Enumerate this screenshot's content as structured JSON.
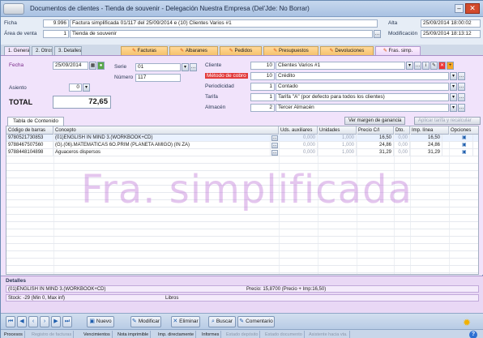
{
  "window": {
    "title": "Documentos de clientes - Tienda de souvenir - Delegación Nuestra Empresa (Del'Jde: No Borrar)"
  },
  "header": {
    "ficha_label": "Ficha",
    "ficha_id": "9.996",
    "ficha_desc": "Factura simplificada 01/117 del 25/09/2014 e (10) Clientes Varios #1",
    "area_label": "Área de venta",
    "area_code": "1",
    "area_name": "Tienda de souvenir",
    "alta_label": "Alta",
    "alta_value": "25/09/2014 18:00:02",
    "mod_label": "Modificación",
    "mod_value": "25/09/2014 18:13:12"
  },
  "tabs": [
    {
      "label": "1. General"
    },
    {
      "label": "2. Otros"
    },
    {
      "label": "3. Detalles"
    },
    {
      "label": "Facturas"
    },
    {
      "label": "Albaranes"
    },
    {
      "label": "Pedidos"
    },
    {
      "label": "Presupuestos"
    },
    {
      "label": "Devoluciones"
    },
    {
      "label": "Fras. simp."
    }
  ],
  "general": {
    "fecha_label": "Fecha",
    "fecha_value": "25/09/2014",
    "asiento_label": "Asiento",
    "asiento_value": "0",
    "total_label": "TOTAL",
    "total_value": "72,65",
    "serie_label": "Serie",
    "serie_value": "01",
    "numero_label": "Número",
    "numero_value": "117",
    "cliente_label": "Cliente",
    "cliente_code": "10",
    "cliente_name": "Clientes Varios #1",
    "metodo_label": "Método de cobro",
    "metodo_code": "10",
    "metodo_name": "Crédito",
    "period_label": "Periodicidad",
    "period_code": "1",
    "period_name": "Contado",
    "tarifa_label": "Tarifa",
    "tarifa_code": "1",
    "tarifa_name": "Tarifa \"A\" (por defecto para todos los clientes)",
    "almacen_label": "Almacén",
    "almacen_code": "2",
    "almacen_name": "Tercer Almacén"
  },
  "contents": {
    "tab_label": "Tabla de Contenido",
    "margin_button": "Ver margen de ganancia",
    "apply_button": "Aplicar tarifa y recalcular"
  },
  "grid": {
    "columns": [
      "Código de barras",
      "Concepto",
      "Uds. auxiliares",
      "Unidades",
      "Precio C/I",
      "Dto.",
      "Imp. línea",
      "Opciones"
    ],
    "rows": [
      {
        "code": "9780521730853",
        "concept": "(01)ENGLISH IN MIND 3.(WORKBOOK+CD)",
        "aux": "0,000",
        "units": "1,000",
        "price": "16,50",
        "dto": "0,00",
        "amount": "16,50"
      },
      {
        "code": "9788467507560",
        "concept": "(G).(06).MATEMATICAS 6O.PRIM (PLANETA AMIGO) (IN ZA)",
        "aux": "0,000",
        "units": "1,000",
        "price": "24,86",
        "dto": "0,00",
        "amount": "24,86"
      },
      {
        "code": "9788448104898",
        "concept": "Aguaceros dispersos",
        "aux": "0,000",
        "units": "1,000",
        "price": "31,29",
        "dto": "0,00",
        "amount": "31,29"
      }
    ]
  },
  "watermark": "Fra. simplificada",
  "details": {
    "title": "Detalles",
    "line1": "(01)ENGLISH IN MIND 3.(WORKBOOK+CD)",
    "price_info": "Precio: 15,8700 (Precio + Imp:16,50)",
    "stock": "Stock: -29 (Min 0, Max inf)",
    "libros": "Libros"
  },
  "toolbar": {
    "nuevo": "Nuevo",
    "modificar": "Modificar",
    "eliminar": "Eliminar",
    "buscar": "Buscar",
    "comentario": "Comentario"
  },
  "statusbar": {
    "items": [
      "Procesos",
      "Registro de facturas",
      "Vencimientos",
      "Nota imprimible",
      "Imp. directamente",
      "Informes",
      "Estado depósito",
      "Estado documento",
      "Asistente hacia vta."
    ]
  }
}
